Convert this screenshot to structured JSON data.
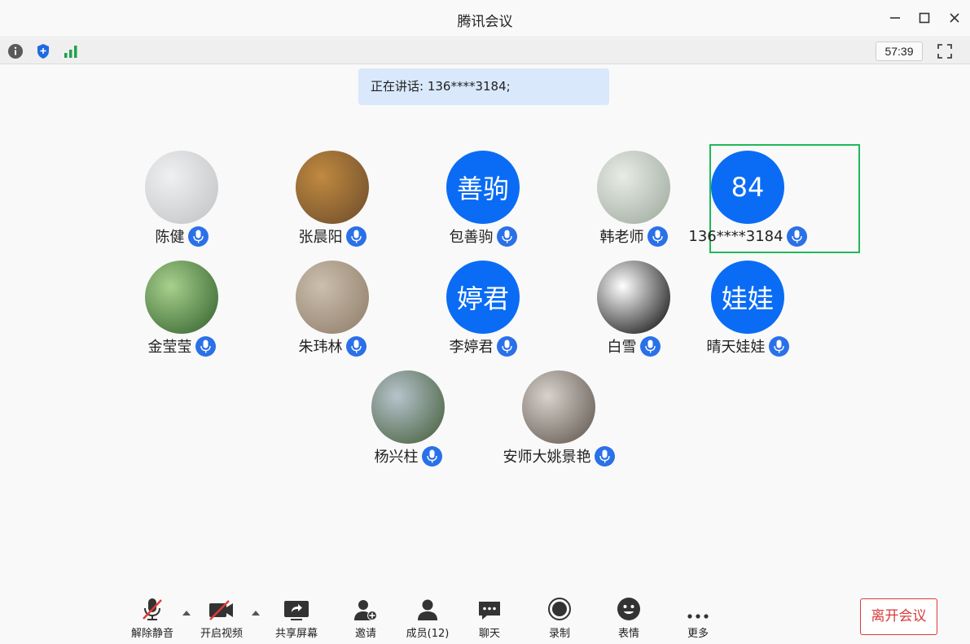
{
  "window": {
    "title": "腾讯会议"
  },
  "toolbar": {
    "timer": "57:39"
  },
  "speaking": {
    "text": "正在讲话: 136****3184;"
  },
  "participants": [
    {
      "name": "陈健",
      "avatar_type": "photo",
      "avatar_label": "",
      "colors": [
        "#bfc1c3",
        "#eef0f1"
      ]
    },
    {
      "name": "张晨阳",
      "avatar_type": "photo",
      "avatar_label": "",
      "colors": [
        "#6a4a2a",
        "#c08a40"
      ]
    },
    {
      "name": "包善驹",
      "avatar_type": "initials",
      "avatar_label": "善驹",
      "colors": [
        "#0a6cf5"
      ]
    },
    {
      "name": "韩老师",
      "avatar_type": "photo",
      "avatar_label": "",
      "colors": [
        "#9aa79a",
        "#e9ece6"
      ]
    },
    {
      "name": "136****3184",
      "avatar_type": "initials",
      "avatar_label": "84",
      "colors": [
        "#0a6cf5"
      ]
    },
    {
      "name": "金莹莹",
      "avatar_type": "photo",
      "avatar_label": "",
      "colors": [
        "#2f5e2a",
        "#a8d08d"
      ]
    },
    {
      "name": "朱玮林",
      "avatar_type": "photo",
      "avatar_label": "",
      "colors": [
        "#8d7a66",
        "#cbbfae"
      ]
    },
    {
      "name": "李婷君",
      "avatar_type": "initials",
      "avatar_label": "婷君",
      "colors": [
        "#0a6cf5"
      ]
    },
    {
      "name": "白雪",
      "avatar_type": "photo",
      "avatar_label": "",
      "colors": [
        "#000000",
        "#ffffff"
      ]
    },
    {
      "name": "晴天娃娃",
      "avatar_type": "initials",
      "avatar_label": "娃娃",
      "colors": [
        "#0a6cf5"
      ]
    },
    {
      "name": "杨兴柱",
      "avatar_type": "photo",
      "avatar_label": "",
      "colors": [
        "#3f5a34",
        "#b7c3cc"
      ]
    },
    {
      "name": "安师大姚景艳",
      "avatar_type": "photo",
      "avatar_label": "",
      "colors": [
        "#5a5048",
        "#d7d2cc"
      ]
    }
  ],
  "controls": {
    "unmute": "解除静音",
    "video": "开启视频",
    "share": "共享屏幕",
    "invite": "邀请",
    "members": "成员(12)",
    "chat": "聊天",
    "record": "录制",
    "emoji": "表情",
    "more": "更多",
    "leave": "离开会议"
  },
  "icons": {
    "info": "info-icon",
    "shield": "shield-icon",
    "signal": "signal-icon",
    "fullscreen": "fullscreen-icon",
    "minimize": "minimize-icon",
    "maximize": "maximize-icon",
    "close": "close-icon"
  },
  "colors": {
    "accent": "#0a6cf5",
    "speaking_bg": "#d9e8fb",
    "active_border": "#20b95a",
    "leave": "#d93a3a"
  }
}
